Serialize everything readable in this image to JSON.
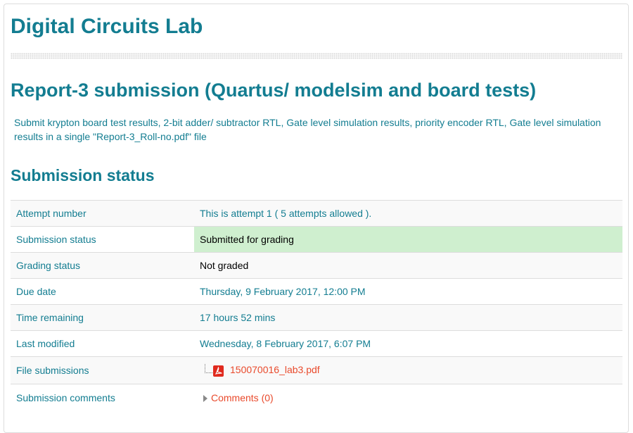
{
  "course": {
    "title": "Digital Circuits Lab"
  },
  "assignment": {
    "title": "Report-3 submission (Quartus/ modelsim and board tests)",
    "intro": "Submit krypton board test results, 2-bit adder/ subtractor RTL, Gate level simulation results, priority encoder RTL, Gate level simulation results in a single \"Report-3_Roll-no.pdf\" file"
  },
  "submission_status": {
    "heading": "Submission status",
    "rows": [
      {
        "label": "Attempt number",
        "value": "This is attempt 1 ( 5 attempts allowed )."
      },
      {
        "label": "Submission status",
        "value": "Submitted for grading"
      },
      {
        "label": "Grading status",
        "value": "Not graded"
      },
      {
        "label": "Due date",
        "value": "Thursday, 9 February 2017, 12:00 PM"
      },
      {
        "label": "Time remaining",
        "value": "17 hours 52 mins"
      },
      {
        "label": "Last modified",
        "value": "Wednesday, 8 February 2017, 6:07 PM"
      },
      {
        "label": "File submissions",
        "value": "150070016_lab3.pdf",
        "icon": "pdf-icon"
      },
      {
        "label": "Submission comments",
        "value": "Comments (0)",
        "icon": "caret-right-icon"
      }
    ]
  },
  "colors": {
    "heading": "#137d91",
    "link": "#e94a2c",
    "submitted_bg": "#cfefcf"
  }
}
